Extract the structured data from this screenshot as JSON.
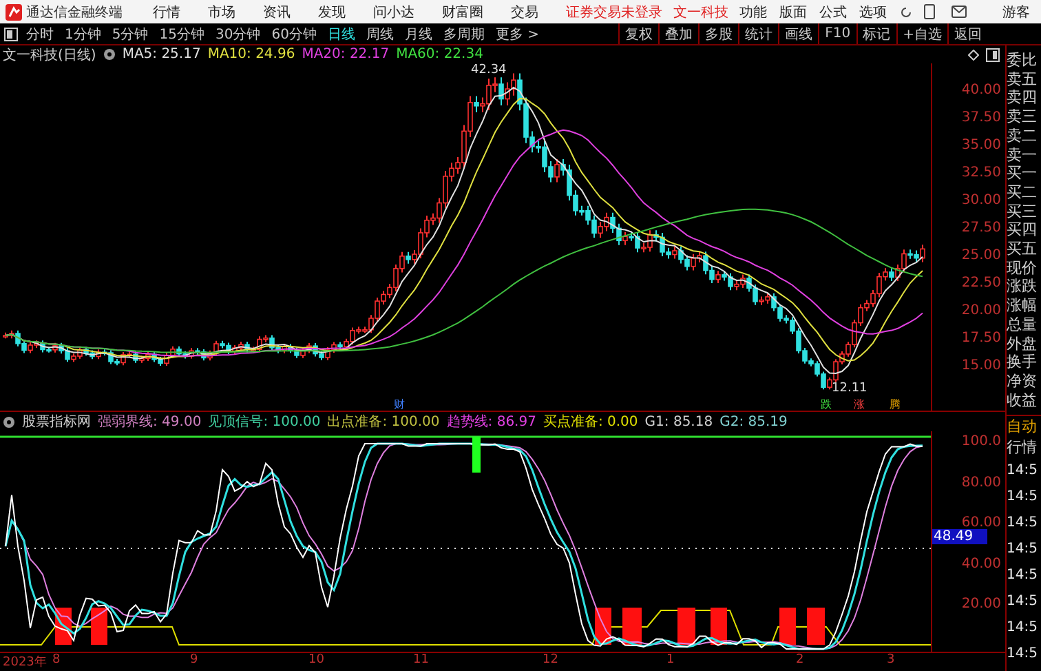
{
  "app": {
    "title": "通达信金融终端",
    "menus": [
      "行情",
      "市场",
      "资讯",
      "发现",
      "问小达",
      "财富圈",
      "交易"
    ],
    "notice": [
      "证券交易未登录",
      "文一科技"
    ],
    "tools": [
      "功能",
      "版面",
      "公式",
      "选项"
    ],
    "user": "游客"
  },
  "periods": [
    {
      "label": "分时",
      "selected": false
    },
    {
      "label": "1分钟",
      "selected": false
    },
    {
      "label": "5分钟",
      "selected": false
    },
    {
      "label": "15分钟",
      "selected": false
    },
    {
      "label": "30分钟",
      "selected": false
    },
    {
      "label": "60分钟",
      "selected": false
    },
    {
      "label": "日线",
      "selected": true
    },
    {
      "label": "周线",
      "selected": false
    },
    {
      "label": "月线",
      "selected": false
    },
    {
      "label": "多周期",
      "selected": false
    },
    {
      "label": "更多 >",
      "selected": false
    }
  ],
  "actions": [
    "复权",
    "叠加",
    "多股",
    "统计",
    "画线",
    "F10",
    "标记",
    "+自选",
    "返回"
  ],
  "info": {
    "title": "文一科技(日线)",
    "averages": [
      {
        "label": "MA5: 25.17",
        "color": "#e0e0e0"
      },
      {
        "label": "MA10: 24.96",
        "color": "#e0e040"
      },
      {
        "label": "MA20: 22.17",
        "color": "#e040e0"
      },
      {
        "label": "MA60: 22.34",
        "color": "#40e040"
      }
    ]
  },
  "price_chart": {
    "high_label": "42.34",
    "low_label": "12.11",
    "axis": [
      "40.00",
      "37.50",
      "35.00",
      "32.50",
      "30.00",
      "27.50",
      "25.00",
      "22.50",
      "20.00",
      "17.50",
      "15.00"
    ],
    "events": [
      {
        "label": "财",
        "color": "#4080ff"
      },
      {
        "label": "跌",
        "color": "#40e040"
      },
      {
        "label": "涨",
        "color": "#ff4040"
      },
      {
        "label": "腾",
        "color": "#e0a000"
      }
    ]
  },
  "quote_labels": [
    "委比",
    "卖五",
    "卖四",
    "卖三",
    "卖二",
    "卖一",
    "买一",
    "买二",
    "买三",
    "买四",
    "买五",
    "现价",
    "涨跌",
    "涨幅",
    "总量",
    "外盘",
    "换手",
    "净资",
    "收益"
  ],
  "indicator": {
    "name": "股票指标网",
    "values": [
      {
        "label": "强弱界线: 49.00",
        "color": "#d080c0"
      },
      {
        "label": "见顶信号: 100.00",
        "color": "#40d0a0"
      },
      {
        "label": "出点准备: 100.00",
        "color": "#c0c040"
      },
      {
        "label": "趋势线: 86.97",
        "color": "#e040e0"
      },
      {
        "label": "买点准备: 0.00",
        "color": "#e0e000"
      },
      {
        "label": "G1: 85.18",
        "color": "#d0d0d0"
      },
      {
        "label": "G2: 85.19",
        "color": "#80d0d0"
      }
    ],
    "axis": [
      "100.0",
      "80.00",
      "60.00",
      "40.00",
      "20.00"
    ],
    "current": "48.49"
  },
  "ticks_panel": {
    "mode": "自动",
    "title": "行情",
    "times": [
      "14:5",
      "14:5",
      "14:5",
      "14:5",
      "14:5",
      "14:5",
      "14:5",
      "14:5"
    ]
  },
  "date_axis": [
    "2023年",
    "8",
    "9",
    "10",
    "11",
    "12",
    "1",
    "2",
    "3"
  ]
}
